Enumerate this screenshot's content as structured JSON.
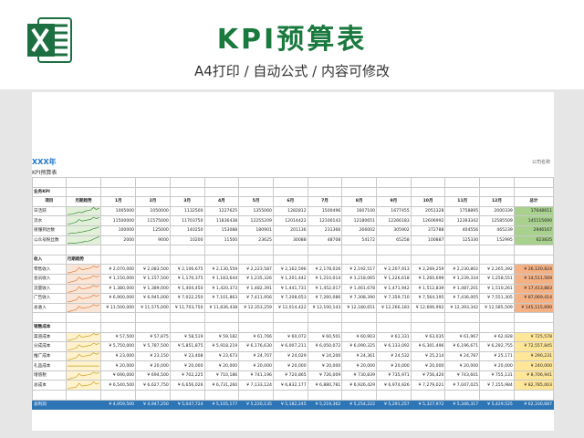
{
  "header": {
    "title": "KPI预算表",
    "subtitle": "A4打印 / 自动公式 / 内容可修改",
    "app_icon": "excel-icon"
  },
  "sheet": {
    "year_title": "XXX年",
    "sub_title": "KPI预算表",
    "company": "公司名称"
  },
  "columns": [
    "项目",
    "月期趋势",
    "1月",
    "2月",
    "3月",
    "4月",
    "5月",
    "6月",
    "7月",
    "8月",
    "9月",
    "10月",
    "11月",
    "12月",
    "总计"
  ],
  "sections": {
    "kpi_label": "业务KPI",
    "income_label": "收入",
    "income_trend": "月期趋势",
    "cost_label": "销售成本",
    "profit_label": "总利润"
  },
  "kpi_rows": [
    {
      "name": "日活跃",
      "values": [
        "1005000",
        "1050000",
        "1132500",
        "1227625",
        "1355060",
        "1282812",
        "1500496",
        "1607100",
        "1677455",
        "2051328",
        "1758895",
        "2000339"
      ],
      "total": "17648611"
    },
    {
      "name": "流水",
      "values": [
        "11500000",
        "11575000",
        "11703750",
        "11836438",
        "12255209",
        "12014422",
        "12100143",
        "12180651",
        "12266183",
        "12606992",
        "12393342",
        "12585509"
      ],
      "total": "145115690"
    },
    {
      "name": "很懂到达数",
      "values": [
        "100000",
        "125000",
        "140250",
        "153088",
        "180901",
        "201136",
        "231366",
        "266002",
        "305902",
        "372788",
        "404556",
        "465239"
      ],
      "total": "2946167"
    },
    {
      "name": "公众号粉丝数",
      "values": [
        "2000",
        "9000",
        "10200",
        "11500",
        "23625",
        "30088",
        "48708",
        "54172",
        "65258",
        "100887",
        "125330",
        "152995"
      ],
      "total": "623835"
    }
  ],
  "income_rows": [
    {
      "name": "零售收入",
      "values": [
        "¥ 2,070,000",
        "¥ 2,083,500",
        "¥ 2,106,675",
        "¥ 2,130,559",
        "¥ 2,223,587",
        "¥ 2,162,596",
        "¥ 2,178,026",
        "¥ 2,192,517",
        "¥ 2,207,913",
        "¥ 2,269,259",
        "¥ 2,230,802",
        "¥ 2,265,392"
      ],
      "total": "¥ 26,120,824"
    },
    {
      "name": "会员收入",
      "values": [
        "¥ 1,150,000",
        "¥ 1,157,500",
        "¥ 1,170,375",
        "¥ 1,183,644",
        "¥ 1,235,326",
        "¥ 1,201,442",
        "¥ 1,210,014",
        "¥ 1,218,065",
        "¥ 1,226,618",
        "¥ 1,260,699",
        "¥ 1,239,334",
        "¥ 1,258,551"
      ],
      "total": "¥ 14,511,569"
    },
    {
      "name": "流量收入",
      "values": [
        "¥ 1,380,000",
        "¥ 1,389,000",
        "¥ 1,404,450",
        "¥ 1,420,373",
        "¥ 1,482,391",
        "¥ 1,441,731",
        "¥ 1,452,017",
        "¥ 1,461,678",
        "¥ 1,471,942",
        "¥ 1,512,839",
        "¥ 1,487,201",
        "¥ 1,510,261"
      ],
      "total": "¥ 17,413,883"
    },
    {
      "name": "广告收入",
      "values": [
        "¥ 6,900,000",
        "¥ 6,945,000",
        "¥ 7,022,250",
        "¥ 7,101,863",
        "¥ 7,411,956",
        "¥ 7,208,653",
        "¥ 7,260,086",
        "¥ 7,308,390",
        "¥ 7,359,710",
        "¥ 7,564,195",
        "¥ 7,436,005",
        "¥ 7,551,305"
      ],
      "total": "¥ 87,069,414"
    },
    {
      "name": "总收入",
      "values": [
        "¥ 11,500,000",
        "¥ 11,575,000",
        "¥ 11,703,750",
        "¥ 11,836,438",
        "¥ 12,353,259",
        "¥ 12,014,422",
        "¥ 12,100,143",
        "¥ 12,180,651",
        "¥ 12,266,183",
        "¥ 12,606,992",
        "¥ 12,393,342",
        "¥ 12,585,509"
      ],
      "total": "¥ 145,115,690"
    }
  ],
  "cost_rows": [
    {
      "name": "渠道成本",
      "values": [
        "¥ 57,500",
        "¥ 57,875",
        "¥ 58,519",
        "¥ 59,182",
        "¥ 61,766",
        "¥ 60,072",
        "¥ 60,501",
        "¥ 60,903",
        "¥ 61,331",
        "¥ 63,035",
        "¥ 61,967",
        "¥ 62,928"
      ],
      "total": "¥ 725,578"
    },
    {
      "name": "分成成本",
      "values": [
        "¥ 5,750,000",
        "¥ 5,787,500",
        "¥ 5,851,875",
        "¥ 5,918,219",
        "¥ 6,176,630",
        "¥ 6,007,211",
        "¥ 6,050,072",
        "¥ 6,090,325",
        "¥ 6,133,092",
        "¥ 6,301,496",
        "¥ 6,196,671",
        "¥ 6,292,755"
      ],
      "total": "¥ 72,557,845"
    },
    {
      "name": "推广成本",
      "values": [
        "¥ 23,000",
        "¥ 23,150",
        "¥ 23,408",
        "¥ 23,673",
        "¥ 24,707",
        "¥ 24,029",
        "¥ 24,200",
        "¥ 24,361",
        "¥ 24,532",
        "¥ 25,214",
        "¥ 24,787",
        "¥ 25,171"
      ],
      "total": "¥ 290,231"
    },
    {
      "name": "礼品成本",
      "values": [
        "¥ 20,000",
        "¥ 20,000",
        "¥ 20,000",
        "¥ 20,000",
        "¥ 20,000",
        "¥ 20,000",
        "¥ 20,000",
        "¥ 20,000",
        "¥ 20,000",
        "¥ 20,000",
        "¥ 20,000",
        "¥ 20,000"
      ],
      "total": "¥ 240,000"
    },
    {
      "name": "增值税",
      "values": [
        "¥ 690,000",
        "¥ 694,500",
        "¥ 702,225",
        "¥ 710,186",
        "¥ 741,196",
        "¥ 720,865",
        "¥ 726,009",
        "¥ 730,839",
        "¥ 735,971",
        "¥ 756,420",
        "¥ 743,601",
        "¥ 755,131"
      ],
      "total": "¥ 8,706,941"
    },
    {
      "name": "总成本",
      "values": [
        "¥ 6,540,500",
        "¥ 6,627,750",
        "¥ 6,656,026",
        "¥ 6,731,260",
        "¥ 7,133,124",
        "¥ 6,832,177",
        "¥ 6,880,781",
        "¥ 6,926,429",
        "¥ 6,974,926",
        "¥ 7,279,021",
        "¥ 7,047,025",
        "¥ 7,155,984"
      ],
      "total": "¥ 82,785,003"
    }
  ],
  "profit_row": {
    "name": "总利润",
    "values": [
      "¥ 4,959,500",
      "¥ 4,947,250",
      "¥ 5,047,724",
      "¥ 5,105,177",
      "¥ 5,220,135",
      "¥ 5,182,245",
      "¥ 5,219,362",
      "¥ 5,254,222",
      "¥ 5,291,257",
      "¥ 5,327,972",
      "¥ 5,346,317",
      "¥ 5,429,525"
    ],
    "total": "¥ 62,330,687"
  },
  "colors": {
    "brand_green": "#1a7a3e",
    "kpi_total": "#a9d18e",
    "income_total": "#f4b183",
    "cost_total": "#ffe699",
    "profit_bar": "#2e75b6"
  }
}
